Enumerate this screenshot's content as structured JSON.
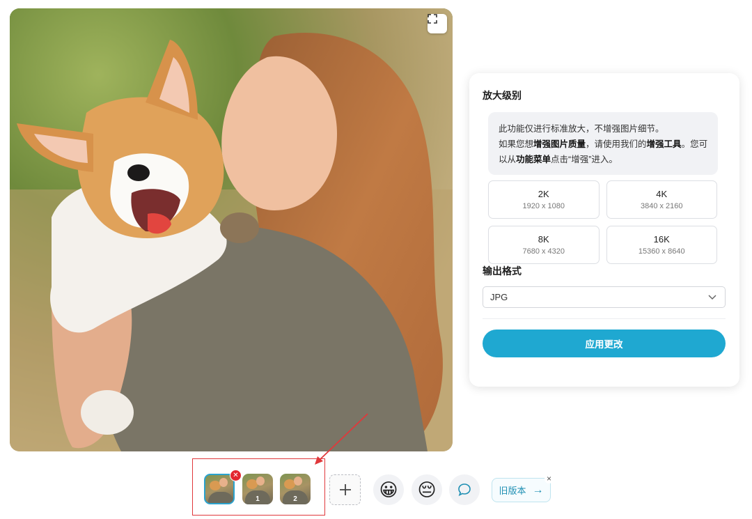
{
  "viewer": {
    "image_description_icon": "photo-woman-with-corgi",
    "expand_icon": "fullscreen-icon"
  },
  "panel": {
    "scale_title": "放大级别",
    "note": {
      "line1": "此功能仅进行标准放大，不增强图片细节。",
      "part_a": "如果您想",
      "bold_quality": "增强图片质量",
      "part_b": "，请使用我们的",
      "bold_tool": "增强工具",
      "part_c": "。您可以从",
      "bold_menu": "功能菜单",
      "part_d": "点击“增强”进入。"
    },
    "resolutions": [
      {
        "name": "2K",
        "dims": "1920 x 1080"
      },
      {
        "name": "4K",
        "dims": "3840 x 2160"
      },
      {
        "name": "8K",
        "dims": "7680 x 4320"
      },
      {
        "name": "16K",
        "dims": "15360 x 8640"
      }
    ],
    "format_title": "输出格式",
    "format_value": "JPG",
    "apply_label": "应用更改"
  },
  "toolbar": {
    "thumbnails": [
      {
        "label": "",
        "active": true
      },
      {
        "label": "1",
        "active": false
      },
      {
        "label": "2",
        "active": false
      }
    ],
    "remove_icon": "close-icon",
    "add_icon": "plus-icon",
    "happy_emoji": "😀",
    "sad_emoji": "😔",
    "chat_icon": "chat-bubble-icon",
    "old_version_label": "旧版本",
    "old_version_arrow": "→",
    "old_version_close": "×"
  },
  "colors": {
    "accent": "#1fa8d1",
    "highlight": "#e0383b",
    "badge": "#e3262f"
  }
}
